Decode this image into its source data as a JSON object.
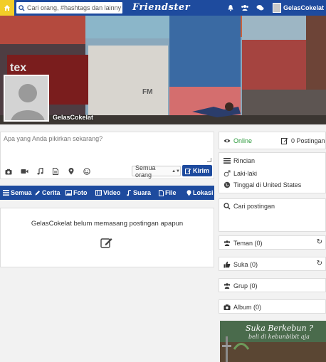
{
  "topbar": {
    "search_placeholder": "Cari orang, #hashtags dan lainnya",
    "logo": "Friendster",
    "username": "GelasCokelat"
  },
  "profile": {
    "name": "GelasCokelat"
  },
  "composer": {
    "placeholder": "Apa yang Anda pikirkan sekarang?",
    "audience": "Semua orang",
    "submit": "Kirim",
    "tools": [
      "camera-icon",
      "video-icon",
      "music-icon",
      "file-icon",
      "location-icon",
      "smiley-icon"
    ]
  },
  "tabs": [
    {
      "label": "Semua",
      "icon": "list-icon"
    },
    {
      "label": "Cerita",
      "icon": "pencil-icon"
    },
    {
      "label": "Foto",
      "icon": "image-icon"
    },
    {
      "label": "Video",
      "icon": "film-icon"
    },
    {
      "label": "Suara",
      "icon": "music-icon"
    },
    {
      "label": "File",
      "icon": "file-icon"
    },
    {
      "label": "Lokasi",
      "icon": "location-icon"
    }
  ],
  "feed": {
    "empty_text": "GelasCokelat belum memasang postingan apapun"
  },
  "sidebar": {
    "status": "Online",
    "post_count": "0 Postingan",
    "details_title": "Rincian",
    "gender": "Laki-laki",
    "location": "Tinggal di United States",
    "search_posts": "Cari postingan",
    "friends": "Teman (0)",
    "likes": "Suka (0)",
    "groups": "Grup (0)",
    "albums": "Album (0)"
  },
  "ad": {
    "title": "Suka Berkebun ?",
    "subtitle": "beli di kebunbibit aja"
  },
  "colors": {
    "brand_blue": "#1e4b9e",
    "home_yellow": "#f2cd28",
    "online_green": "#2e9b3e"
  }
}
